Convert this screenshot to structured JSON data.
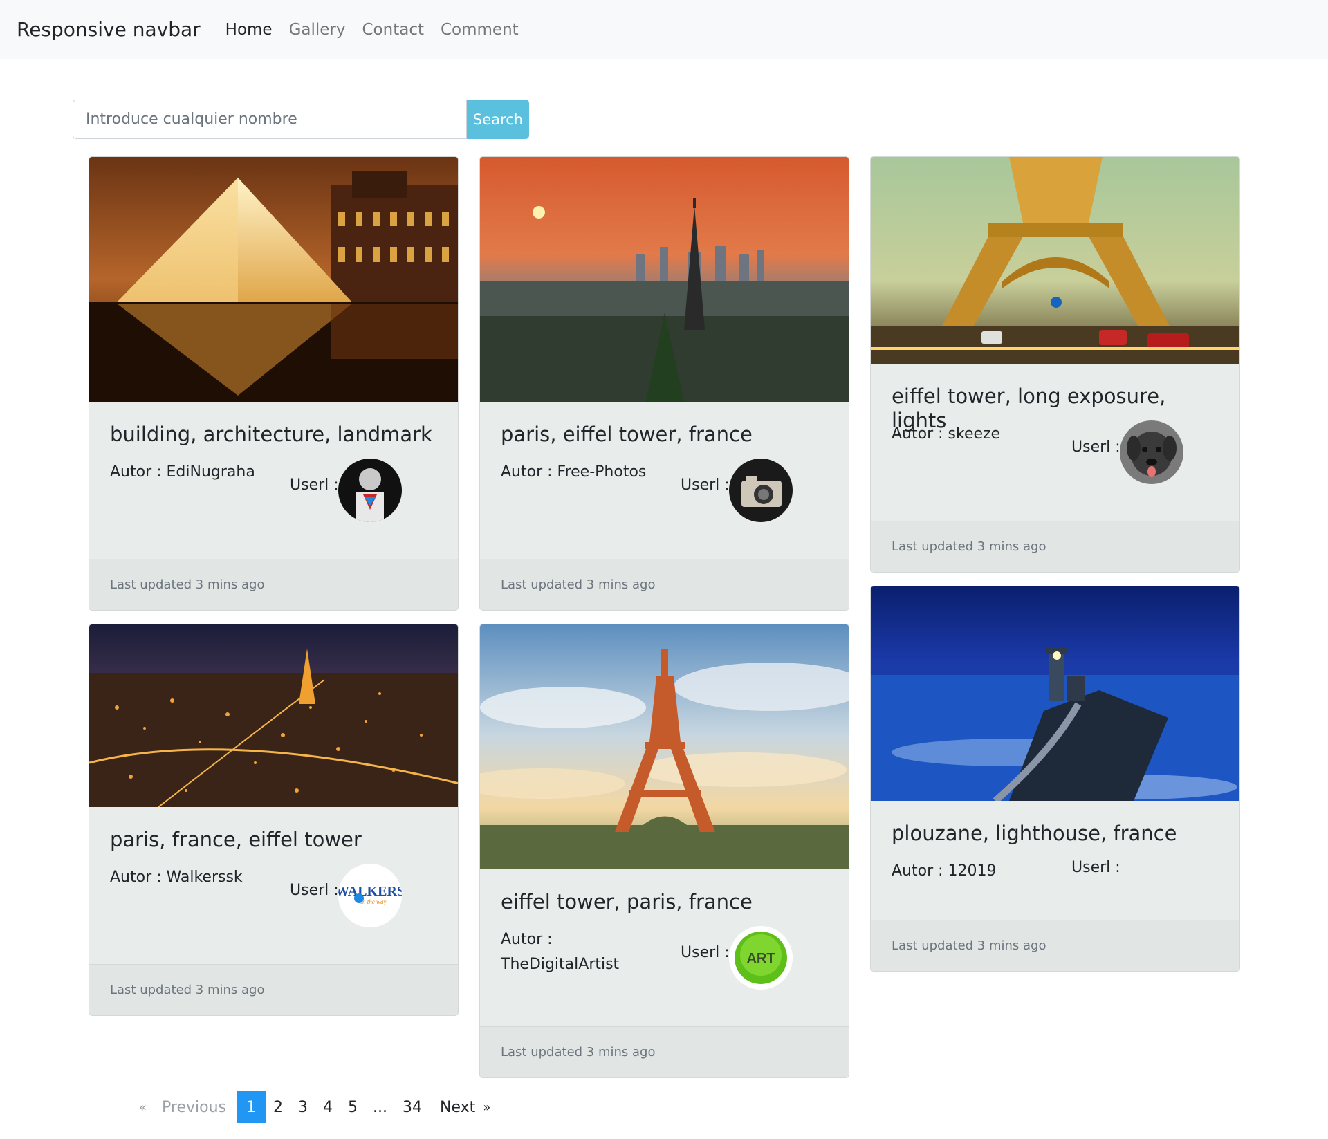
{
  "navbar": {
    "brand": "Responsive navbar",
    "links": [
      "Home",
      "Gallery",
      "Contact",
      "Comment"
    ]
  },
  "search": {
    "placeholder": "Introduce cualquier nombre",
    "button": "Search"
  },
  "cards": [
    {
      "title": "building, architecture, landmark",
      "autor": "Autor : EdiNugraha",
      "userl": "Userl :",
      "footer": "Last updated 3 mins ago",
      "avatar": "superman-avatar"
    },
    {
      "title": "paris, eiffel tower, france",
      "autor": "Autor : Free-Photos",
      "userl": "Userl :",
      "footer": "Last updated 3 mins ago",
      "avatar": "camera-avatar"
    },
    {
      "title": "eiffel tower, long exposure, lights",
      "autor": "Autor : skeeze",
      "userl": "Userl :",
      "footer": "Last updated 3 mins ago",
      "avatar": "dog-avatar"
    },
    {
      "title": "paris, france, eiffel tower",
      "autor": "Autor : Walkerssk",
      "userl": "Userl :",
      "footer": "Last updated 3 mins ago",
      "avatar": "walkers-logo-avatar",
      "avatar_text": "WALKERS"
    },
    {
      "title": "eiffel tower, paris, france",
      "autor": "Autor : TheDigitalArtist",
      "userl": "Userl :",
      "footer": "Last updated 3 mins ago",
      "avatar": "art-button-avatar",
      "avatar_text": "ART"
    },
    {
      "title": "plouzane, lighthouse, france",
      "autor": "Autor : 12019",
      "userl": "Userl :",
      "footer": "Last updated 3 mins ago"
    }
  ],
  "pagination": {
    "prev_arrow": "«",
    "prev": "Previous",
    "pages": [
      "1",
      "2",
      "3",
      "4",
      "5",
      "...",
      "34"
    ],
    "next": "Next",
    "next_arrow": "»",
    "active": "1"
  },
  "colors": {
    "navbar_bg": "#f8f9fa",
    "search_button": "#5bc0de",
    "card_bg": "#e8edeb",
    "active_page": "#2196f3"
  }
}
